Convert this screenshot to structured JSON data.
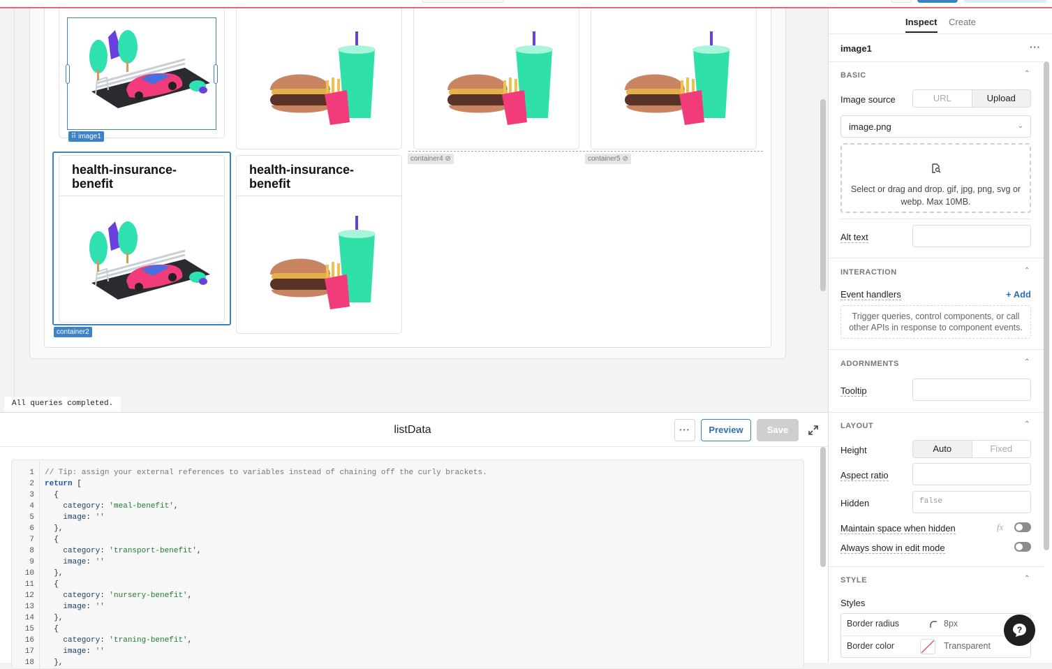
{
  "canvas": {
    "cards": [
      {
        "name": "car-card-1",
        "title": ""
      },
      {
        "name": "food-card-1",
        "title": ""
      },
      {
        "name": "food-card-2",
        "title": ""
      },
      {
        "name": "food-card-3",
        "title": ""
      },
      {
        "name": "car-card-2",
        "title": "health-insurance-benefit"
      },
      {
        "name": "food-card-4",
        "title": "health-insurance-benefit"
      }
    ],
    "tags": {
      "image1": "⠿ image1",
      "container4": "container4",
      "container5": "container5",
      "container2": "container2"
    },
    "status": "All queries completed."
  },
  "editor": {
    "query_name": "listData",
    "more_label": "···",
    "preview_label": "Preview",
    "save_label": "Save",
    "lines": [
      {
        "n": "1",
        "parts": [
          {
            "c": "c-com",
            "t": "// Tip: assign your external references to variables instead of chaining off the curly brackets."
          }
        ]
      },
      {
        "n": "2",
        "parts": [
          {
            "c": "c-kw",
            "t": "return"
          },
          {
            "c": "",
            "t": " ["
          }
        ]
      },
      {
        "n": "3",
        "parts": [
          {
            "c": "",
            "t": "  {"
          }
        ]
      },
      {
        "n": "4",
        "parts": [
          {
            "c": "c-prop",
            "t": "    category"
          },
          {
            "c": "",
            "t": ": "
          },
          {
            "c": "c-str",
            "t": "'meal-benefit'"
          },
          {
            "c": "",
            "t": ","
          }
        ]
      },
      {
        "n": "5",
        "parts": [
          {
            "c": "c-prop",
            "t": "    image"
          },
          {
            "c": "",
            "t": ": "
          },
          {
            "c": "c-str",
            "t": "''"
          }
        ]
      },
      {
        "n": "6",
        "parts": [
          {
            "c": "",
            "t": "  },"
          }
        ]
      },
      {
        "n": "7",
        "parts": [
          {
            "c": "",
            "t": "  {"
          }
        ]
      },
      {
        "n": "8",
        "parts": [
          {
            "c": "c-prop",
            "t": "    category"
          },
          {
            "c": "",
            "t": ": "
          },
          {
            "c": "c-str",
            "t": "'transport-benefit'"
          },
          {
            "c": "",
            "t": ","
          }
        ]
      },
      {
        "n": "9",
        "parts": [
          {
            "c": "c-prop",
            "t": "    image"
          },
          {
            "c": "",
            "t": ": "
          },
          {
            "c": "c-str",
            "t": "''"
          }
        ]
      },
      {
        "n": "10",
        "parts": [
          {
            "c": "",
            "t": "  },"
          }
        ]
      },
      {
        "n": "11",
        "parts": [
          {
            "c": "",
            "t": "  {"
          }
        ]
      },
      {
        "n": "12",
        "parts": [
          {
            "c": "c-prop",
            "t": "    category"
          },
          {
            "c": "",
            "t": ": "
          },
          {
            "c": "c-str",
            "t": "'nursery-benefit'"
          },
          {
            "c": "",
            "t": ","
          }
        ]
      },
      {
        "n": "13",
        "parts": [
          {
            "c": "c-prop",
            "t": "    image"
          },
          {
            "c": "",
            "t": ": "
          },
          {
            "c": "c-str",
            "t": "''"
          }
        ]
      },
      {
        "n": "14",
        "parts": [
          {
            "c": "",
            "t": "  },"
          }
        ]
      },
      {
        "n": "15",
        "parts": [
          {
            "c": "",
            "t": "  {"
          }
        ]
      },
      {
        "n": "16",
        "parts": [
          {
            "c": "c-prop",
            "t": "    category"
          },
          {
            "c": "",
            "t": ": "
          },
          {
            "c": "c-str",
            "t": "'traning-benefit'"
          },
          {
            "c": "",
            "t": ","
          }
        ]
      },
      {
        "n": "17",
        "parts": [
          {
            "c": "c-prop",
            "t": "    image"
          },
          {
            "c": "",
            "t": ": "
          },
          {
            "c": "c-str",
            "t": "''"
          }
        ]
      },
      {
        "n": "18",
        "parts": [
          {
            "c": "",
            "t": "  },"
          }
        ]
      }
    ]
  },
  "panel": {
    "tabs": {
      "inspect": "Inspect",
      "create": "Create"
    },
    "component": "image1",
    "more": "···",
    "basic": {
      "heading": "BASIC",
      "image_source_label": "Image source",
      "source_options": [
        "URL",
        "Upload"
      ],
      "selected_source": "Upload",
      "file_value": "image.png",
      "drop_text": "Select or drag and drop. gif, jpg, png, svg or webp. Max 10MB.",
      "alt_text_label": "Alt text",
      "alt_text_value": ""
    },
    "interaction": {
      "heading": "INTERACTION",
      "event_handlers_label": "Event handlers",
      "add_label": "+ Add",
      "empty_text": "Trigger queries, control components, or call other APIs in response to component events."
    },
    "adornments": {
      "heading": "ADORNMENTS",
      "tooltip_label": "Tooltip",
      "tooltip_value": ""
    },
    "layout": {
      "heading": "LAYOUT",
      "height_label": "Height",
      "height_options": [
        "Auto",
        "Fixed"
      ],
      "selected_height": "Auto",
      "aspect_ratio_label": "Aspect ratio",
      "aspect_ratio_value": "",
      "hidden_label": "Hidden",
      "hidden_placeholder": "false",
      "maintain_space_label": "Maintain space when hidden",
      "fx_label": "fx",
      "maintain_space_on": false,
      "always_show_label": "Always show in edit mode",
      "always_show_on": false
    },
    "style": {
      "heading": "STYLE",
      "styles_label": "Styles",
      "border_radius_label": "Border radius",
      "border_radius_value": "8px",
      "border_color_label": "Border color",
      "border_color_value": "Transparent"
    }
  },
  "colors": {
    "accent": "#3c82c4",
    "divider": "#e26a77"
  }
}
